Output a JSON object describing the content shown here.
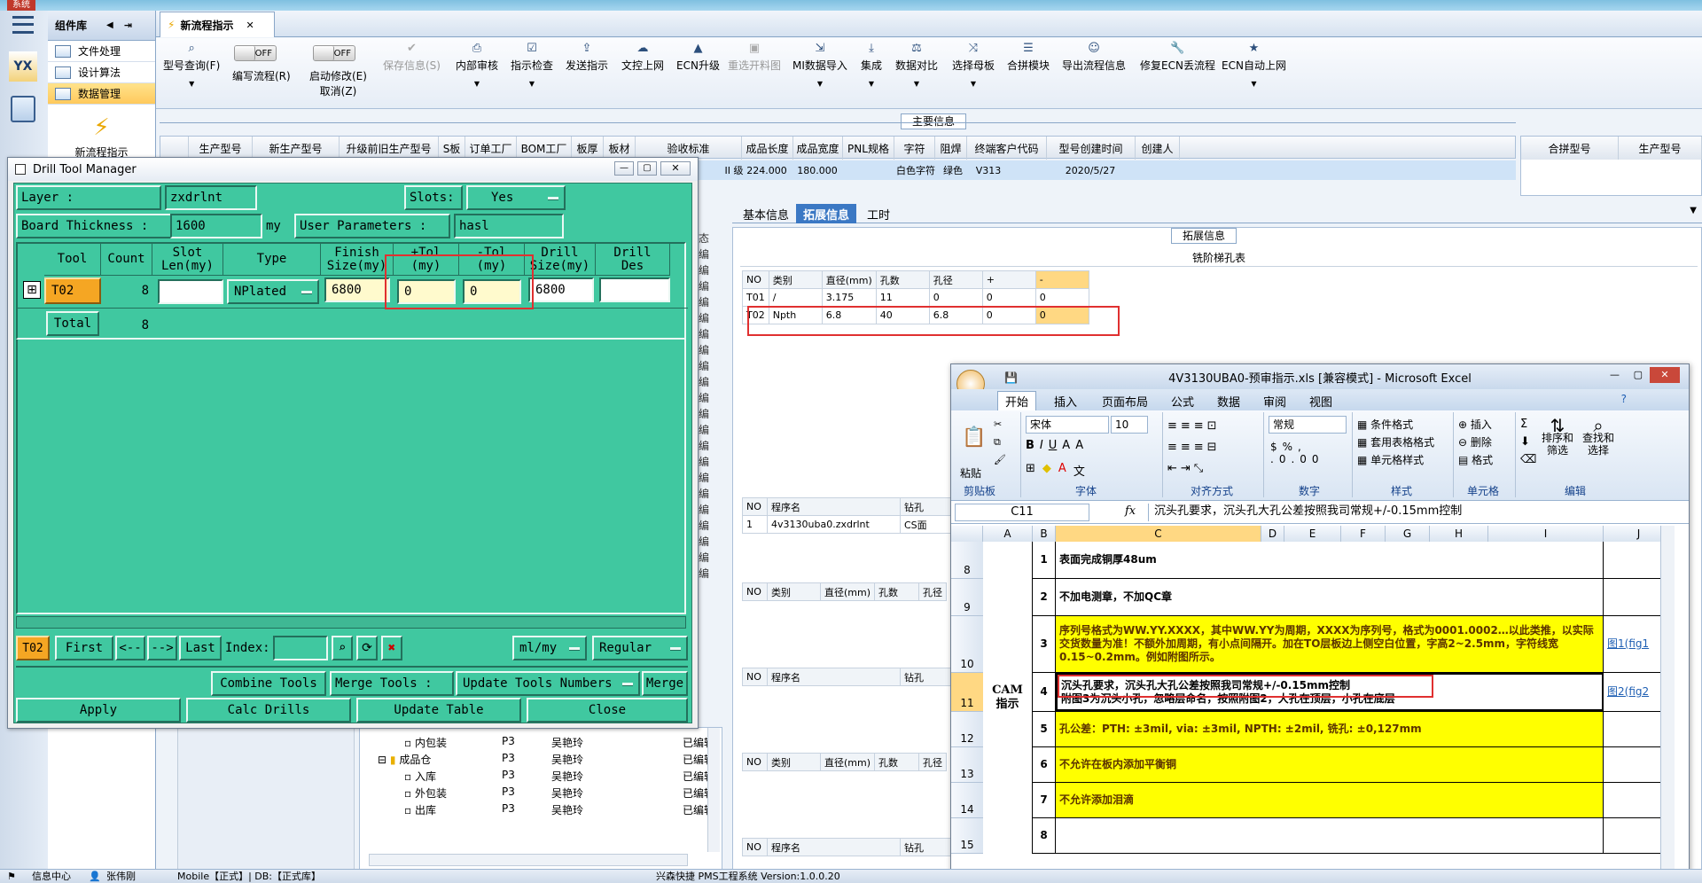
{
  "app": {
    "top_caption": "系统",
    "component_bar_title": "组件库",
    "nav_items": [
      {
        "label": "文件处理"
      },
      {
        "label": "设计算法"
      },
      {
        "label": "数据管理"
      }
    ],
    "new_process_label": "新流程指示",
    "active_tab": "新流程指示",
    "left_logo": "YX"
  },
  "ribbon": {
    "buttons": [
      {
        "label": "型号查询(F)",
        "icon": "search-icon"
      },
      {
        "label": "编写流程(R)",
        "toggle": "OFF"
      },
      {
        "label": "启动修改(E)",
        "label2": "取消(Z)",
        "toggle": "OFF"
      },
      {
        "label": "保存信息(S)",
        "icon": "check-icon",
        "disabled": true
      },
      {
        "label": "内部审核",
        "icon": "printer-icon"
      },
      {
        "label": "指示检查",
        "icon": "check-icon"
      },
      {
        "label": "发送指示",
        "icon": "upload-icon"
      },
      {
        "label": "文控上网",
        "icon": "cloud-upload-icon"
      },
      {
        "label": "ECN升级",
        "icon": "level-icon"
      },
      {
        "label": "重选开料图",
        "icon": "image-icon",
        "disabled": true
      },
      {
        "label": "MI数据导入",
        "icon": "import-icon"
      },
      {
        "label": "集成",
        "icon": "download-icon"
      },
      {
        "label": "数据对比",
        "icon": "compare-icon"
      },
      {
        "label": "选择母板",
        "icon": "shuffle-icon"
      },
      {
        "label": "合拼模块",
        "icon": "list-icon"
      },
      {
        "label": "导出流程信息",
        "icon": "smile-icon"
      },
      {
        "label": "修复ECN丢流程",
        "icon": "wrench-icon"
      },
      {
        "label": "ECN自动上网",
        "icon": "star-icon"
      }
    ]
  },
  "main_info": {
    "section_title": "主要信息",
    "columns": [
      "生产型号",
      "新生产型号",
      "升级前旧生产型号",
      "S板",
      "订单工厂",
      "BOM工厂",
      "板厚",
      "板材",
      "验收标准",
      "成品长度",
      "成品宽度",
      "PNL规格",
      "字符",
      "阻焊",
      "终端客户代码",
      "型号创建时间",
      "创建人"
    ],
    "row": {
      "验收标准": "II 级",
      "成品长度": "224.000",
      "成品宽度": "180.000",
      "字符": "白色字符",
      "阻焊": "绿色",
      "终端客户代码": "V313",
      "型号创建时间": "2020/5/27"
    },
    "right_columns": [
      "合拼型号",
      "生产型号"
    ]
  },
  "lower_tabs": {
    "tabs": [
      "基本信息",
      "拓展信息",
      "工时"
    ],
    "active": "拓展信息",
    "ext_title": "拓展信息",
    "milling_title": "铣阶梯孔表",
    "milling_headers": [
      "NO",
      "类别",
      "直径(mm)",
      "孔数",
      "孔径",
      "+",
      "-"
    ],
    "milling_rows": [
      [
        "T01",
        "/",
        "3.175",
        "11",
        "0",
        "0",
        "0"
      ],
      [
        "T02",
        "Npth",
        "6.8",
        "40",
        "6.8",
        "0",
        "0"
      ]
    ],
    "prog_headers": [
      "NO",
      "程序名",
      "钻孔"
    ],
    "prog_rows": [
      [
        "1",
        "4v3130uba0.zxdrlnt",
        "CS面"
      ]
    ],
    "blank_headers_a": [
      "NO",
      "类别",
      "直径(mm)",
      "孔数",
      "孔径"
    ],
    "blank_headers_b": [
      "NO",
      "程序名",
      "钻孔"
    ]
  },
  "tree": {
    "items": [
      {
        "name": "内包装",
        "c1": "P3",
        "c2": "吴艳玲",
        "c3": "已编辑"
      },
      {
        "name": "成品仓",
        "c1": "P3",
        "c2": "吴艳玲",
        "c3": "已编辑"
      },
      {
        "name": "入库",
        "c1": "P3",
        "c2": "吴艳玲",
        "c3": "已编辑"
      },
      {
        "name": "外包装",
        "c1": "P3",
        "c2": "吴艳玲",
        "c3": "已编辑"
      },
      {
        "name": "出库",
        "c1": "P3",
        "c2": "吴艳玲",
        "c3": "已编辑"
      }
    ],
    "side_fragments": [
      "态",
      "编",
      "编",
      "编",
      "编",
      "编",
      "编",
      "编",
      "编",
      "编",
      "编",
      "编",
      "编",
      "编",
      "编",
      "编",
      "编",
      "编",
      "编",
      "编",
      "编",
      "编"
    ]
  },
  "drill_tool_manager": {
    "title": "Drill Tool Manager",
    "layer_label": "Layer          :",
    "layer_value": "zxdrlnt",
    "slots_label": "Slots:",
    "slots_value": "Yes",
    "thickness_label": "Board Thickness :",
    "thickness_value": "1600",
    "thickness_unit": "my",
    "user_params_label": "User Parameters :",
    "user_params_value": "hasl",
    "headers": [
      "Tool",
      "Count",
      "Slot\nLen(my)",
      "Type",
      "Finish\nSize(my)",
      "+Tol\n(my)",
      "-Tol\n(my)",
      "Drill\nSize(my)",
      "Drill\nDes"
    ],
    "row": {
      "tool": "T02",
      "count": "8",
      "type": "NPlated",
      "finish": "6800",
      "plus_tol": "0",
      "minus_tol": "0",
      "drill_size": "6800"
    },
    "total_label": "Total",
    "total_count": "8",
    "nav": {
      "current": "T02",
      "first": "First",
      "prev": "<--",
      "next": "-->",
      "last": "Last",
      "index_label": "Index:",
      "unit": "ml/my",
      "mode": "Regular"
    },
    "combine_label": "Combine Tools",
    "merge_label": "Merge Tools :",
    "merge_dropdown": "Update Tools Numbers",
    "merge_btn": "Merge",
    "apply": "Apply",
    "calc": "Calc Drills",
    "update": "Update Table",
    "close": "Close"
  },
  "excel": {
    "title": "4V3130UBA0-预审指示.xls  [兼容模式] - Microsoft Excel",
    "tabs": [
      "开始",
      "插入",
      "页面布局",
      "公式",
      "数据",
      "审阅",
      "视图"
    ],
    "font_name": "宋体",
    "font_size": "10",
    "number_format": "常规",
    "group_labels": [
      "剪贴板",
      "字体",
      "对齐方式",
      "数字",
      "样式",
      "单元格",
      "编辑"
    ],
    "style_items": [
      "条件格式",
      "套用表格格式",
      "单元格样式"
    ],
    "cell_items": [
      "插入",
      "删除",
      "格式"
    ],
    "edit_items": [
      "排序和筛选",
      "查找和选择"
    ],
    "paste_label": "粘贴",
    "name_box": "C11",
    "formula": "沉头孔要求，沉头孔大孔公差按照我司常规+/-0.15mm控制",
    "columns": [
      "A",
      "B",
      "C",
      "D",
      "E",
      "F",
      "G",
      "H",
      "I",
      "J"
    ],
    "row_numbers": [
      "8",
      "9",
      "10",
      "11",
      "12",
      "13",
      "14",
      "15"
    ],
    "cam_label": "CAM\n指示",
    "rows": [
      {
        "n": "1",
        "text": "表面完成铜厚48um",
        "yellow": false,
        "link": ""
      },
      {
        "n": "2",
        "text": "不加电测章，不加QC章",
        "yellow": false,
        "link": ""
      },
      {
        "n": "3",
        "text": "序列号格式为WW.YY.XXXX，其中WW.YY为周期，XXXX为序列号，格式为0001.0002…以此类推，以实际交货数量为准！不额外加周期，有小点间隔开。加在TO层板边上侧空白位置，字高2~2.5mm，字符线宽0.15~0.2mm。例如附图所示。",
        "yellow": true,
        "link": "图1(fig1"
      },
      {
        "n": "4",
        "text": "沉头孔要求，沉头孔大孔公差按照我司常规+/-0.15mm控制\n附图3为沉头小孔，忽略层命名，按照附图2，大孔在顶层，小孔在底层",
        "yellow": false,
        "link": "图2(fig2"
      },
      {
        "n": "5",
        "text": "孔公差：PTH: ±3mil,  via: ±3mil,  NPTH: ±2mil,  铣孔: ±0,127mm",
        "yellow": true,
        "link": ""
      },
      {
        "n": "6",
        "text": "不允许在板内添加平衡铜",
        "yellow": true,
        "link": ""
      },
      {
        "n": "7",
        "text": "不允许添加泪滴",
        "yellow": true,
        "link": ""
      },
      {
        "n": "8",
        "text": "",
        "yellow": false,
        "link": ""
      }
    ]
  },
  "status": {
    "left": "信息中心",
    "user": "张伟刚",
    "mid": "Mobile【正式】| DB:【正式库】",
    "right": "兴森快捷  PMS工程系统  Version:1.0.0.20"
  },
  "colors": {
    "drill_bg": "#40c8a0",
    "excel_yellow": "#ffff00",
    "tab_active": "#3b78c4",
    "highlight_red": "#e03030"
  }
}
